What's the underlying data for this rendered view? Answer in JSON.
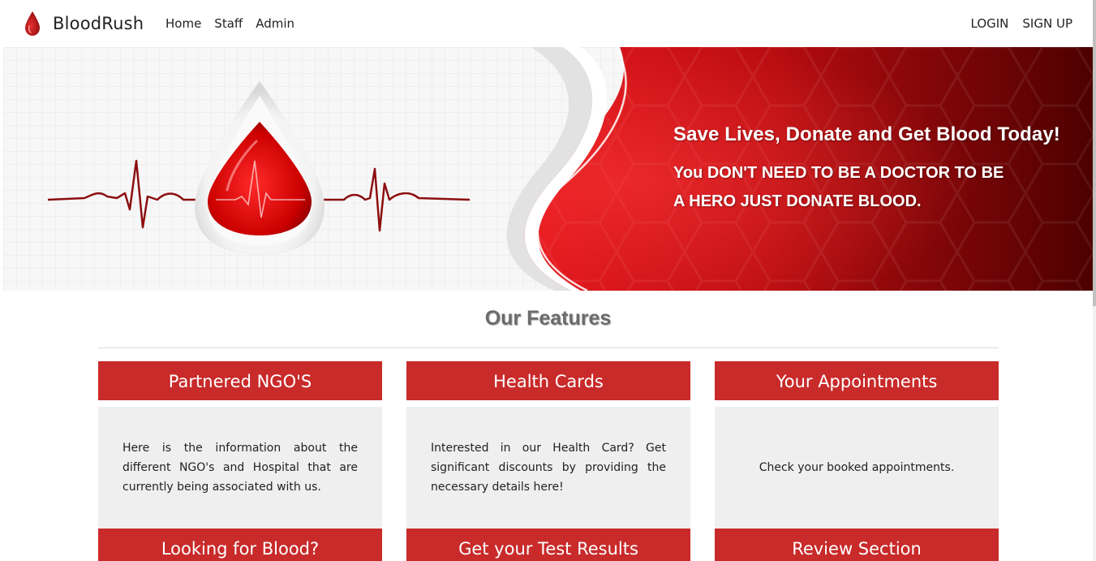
{
  "brand": {
    "name": "BloodRush"
  },
  "nav": {
    "left": [
      {
        "label": "Home"
      },
      {
        "label": "Staff"
      },
      {
        "label": "Admin"
      }
    ],
    "right": [
      {
        "label": "LOGIN"
      },
      {
        "label": "SIGN UP"
      }
    ]
  },
  "hero": {
    "headline": "Save Lives, Donate and Get Blood Today!",
    "sub_line1": "You DON'T NEED TO BE A DOCTOR TO BE",
    "sub_line2": "A HERO JUST DONATE BLOOD."
  },
  "features": {
    "title": "Our Features",
    "cards": [
      {
        "title": "Partnered NGO'S",
        "description": "Here is the information about the different NGO's and Hospital that are currently being associated with us."
      },
      {
        "title": "Health Cards",
        "description": "Interested in our Health Card? Get significant discounts by providing the necessary details here!"
      },
      {
        "title": "Your Appointments",
        "description": "Check your booked appointments."
      },
      {
        "title": "Looking for Blood?"
      },
      {
        "title": "Get your Test Results"
      },
      {
        "title": "Review Section"
      }
    ]
  },
  "colors": {
    "accent_red": "#c92a2a",
    "card_body_bg": "#efefef",
    "hero_dark_red": "#5a0000",
    "title_gray": "#6b6b6b"
  },
  "icons": {
    "brand_logo": "blood-drop-icon"
  }
}
